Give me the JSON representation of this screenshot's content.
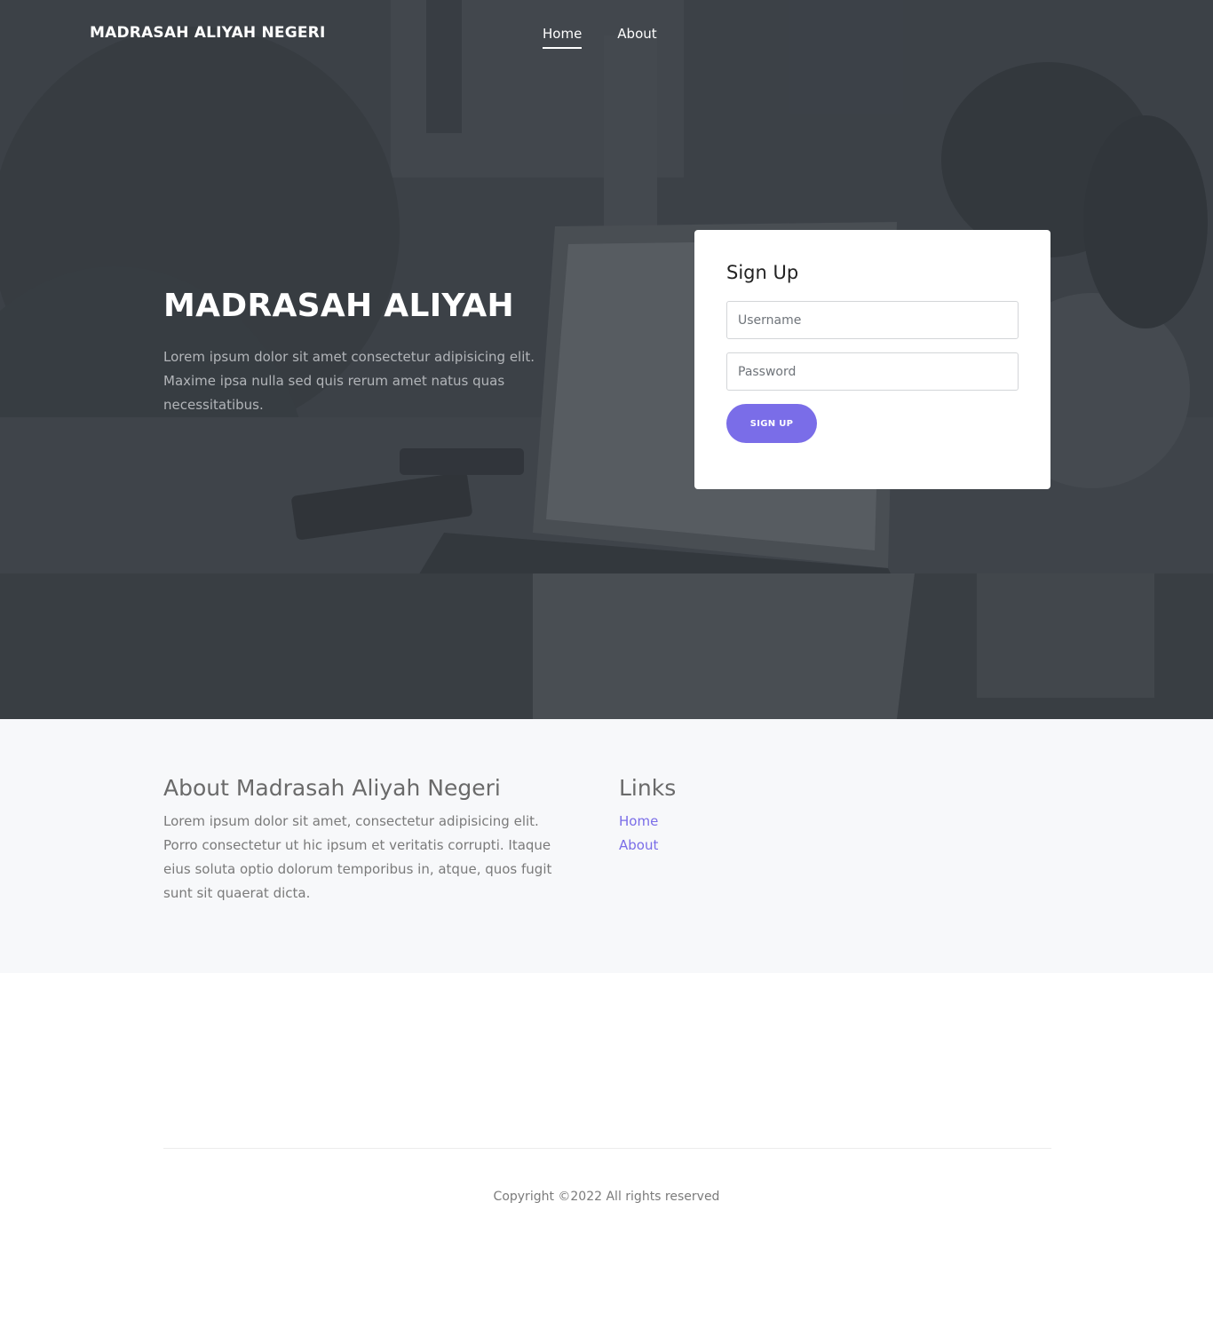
{
  "header": {
    "brand": "MADRASAH ALIYAH NEGERI",
    "nav": [
      {
        "label": "Home",
        "active": true
      },
      {
        "label": "About",
        "active": false
      }
    ]
  },
  "hero": {
    "title": "MADRASAH ALIYAH",
    "text": "Lorem ipsum dolor sit amet consectetur adipisicing elit. Maxime ipsa nulla sed quis rerum amet natus quas necessitatibus."
  },
  "signup": {
    "title": "Sign Up",
    "username_placeholder": "Username",
    "password_placeholder": "Password",
    "button_label": "SIGN UP"
  },
  "about": {
    "title": "About Madrasah Aliyah Negeri",
    "text": "Lorem ipsum dolor sit amet, consectetur adipisicing elit. Porro consectetur ut hic ipsum et veritatis corrupti. Itaque eius soluta optio dolorum temporibus in, atque, quos fugit sunt sit quaerat dicta."
  },
  "links": {
    "title": "Links",
    "items": [
      "Home",
      "About"
    ]
  },
  "footer": {
    "copyright": "Copyright ©2022 All rights reserved"
  },
  "colors": {
    "accent": "#7a6de8",
    "hero_overlay": "#3e4349",
    "section_bg": "#f7f8fa"
  }
}
